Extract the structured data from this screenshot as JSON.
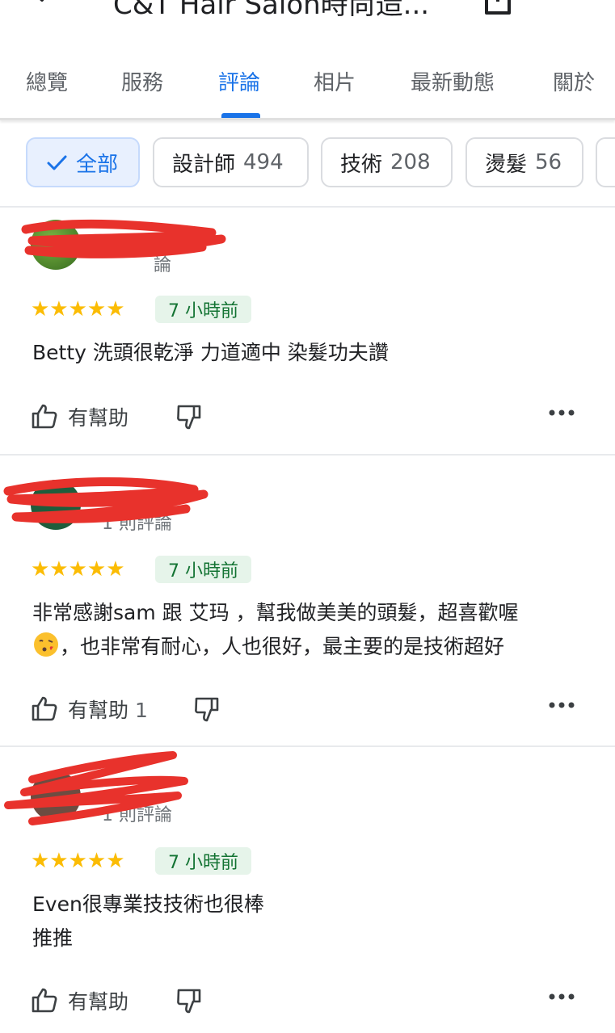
{
  "header": {
    "title": "C&T Hair Salon時尚造...",
    "back_icon": "back-arrow-icon",
    "share_icon": "share-icon",
    "more_icon": "more-vert-icon"
  },
  "tabs": [
    {
      "label": "總覽"
    },
    {
      "label": "服務"
    },
    {
      "label": "評論",
      "active": true
    },
    {
      "label": "相片"
    },
    {
      "label": "最新動態"
    },
    {
      "label": "關於"
    }
  ],
  "chips": [
    {
      "label": "全部",
      "count": "",
      "selected": true
    },
    {
      "label": "設計師",
      "count": "494"
    },
    {
      "label": "技術",
      "count": "208"
    },
    {
      "label": "燙髮",
      "count": "56"
    }
  ],
  "reviews": [
    {
      "review_count": "論",
      "stars": "★★★★★",
      "time": "7 小時前",
      "text": "Betty 洗頭很乾淨 力道適中 染髮功夫讚",
      "helpful_label": "有幫助",
      "helpful_count": ""
    },
    {
      "review_count": "1 則評論",
      "stars": "★★★★★",
      "time": "7 小時前",
      "text_line1": "非常感謝sam 跟 艾玛 ，幫我做美美的頭髮，超喜歡喔",
      "text_line2": "，也非常有耐心，人也很好，最主要的是技術超好",
      "helpful_label": "有幫助",
      "helpful_count": "1"
    },
    {
      "review_count": "1 則評論",
      "stars": "★★★★★",
      "time": "7 小時前",
      "text_line1": "Even很專業技技術也很棒",
      "text_line2": "推推",
      "helpful_label": "有幫助",
      "helpful_count": ""
    }
  ],
  "colors": {
    "accent": "#1a73e8",
    "star": "#fbbc04",
    "badge_bg": "#e6f4ea",
    "badge_text": "#137333",
    "redaction": "#e8322c"
  }
}
